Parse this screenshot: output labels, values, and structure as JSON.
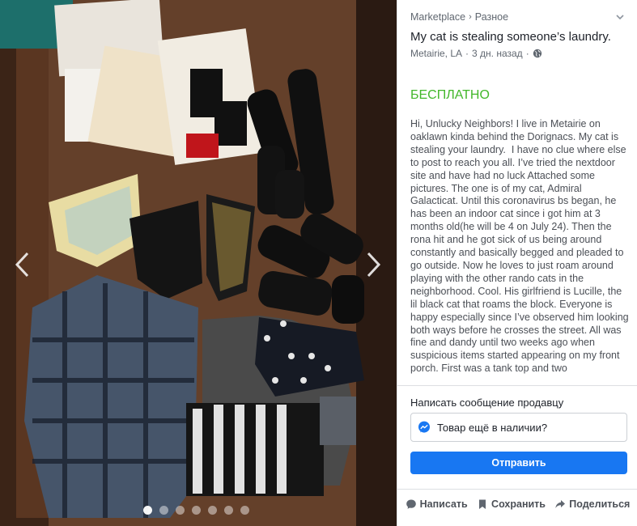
{
  "breadcrumb": {
    "root": "Marketplace",
    "sep": "›",
    "category": "Разное"
  },
  "listing": {
    "title": "My cat is stealing someone’s laundry.",
    "location": "Metairie, LA",
    "dot": "·",
    "age": "3 дн. назад",
    "price": "БЕСПЛАТНО",
    "description": "Hi, Unlucky Neighbors! I live in Metairie on oaklawn kinda behind the Dorignacs. My cat is stealing your laundry.  I have no clue where else to post to reach you all. I’ve tried the nextdoor site and have had no luck Attached some pictures. The one is of my cat, Admiral Galacticat. Until this coronavirus bs began, he has been an indoor cat since i got him at 3 months old(he will be 4 on July 24). Then the rona hit and he got sick of us being around constantly and basically begged and pleaded to go outside. Now he loves to just roam around playing with the other rando cats in the neighborhood. Cool. His girlfriend is Lucille, the lil black cat that roams the block. Everyone is happy especially since I’ve observed him looking both ways before he crosses the street. All was fine and dandy until two weeks ago when suspicious items started appearing on my front porch. First was a tank top and two"
  },
  "message": {
    "label": "Написать сообщение продавцу",
    "input_value": "Товар ещё в наличии?",
    "send_label": "Отправить"
  },
  "actions": {
    "message_label": "Написать",
    "save_label": "Сохранить",
    "share_label": "Поделиться"
  },
  "gallery": {
    "image_count": 7,
    "active_index": 0
  },
  "colors": {
    "accent": "#1877f2",
    "price": "#42b72a",
    "text": "#1d2129",
    "muted": "#606770"
  }
}
